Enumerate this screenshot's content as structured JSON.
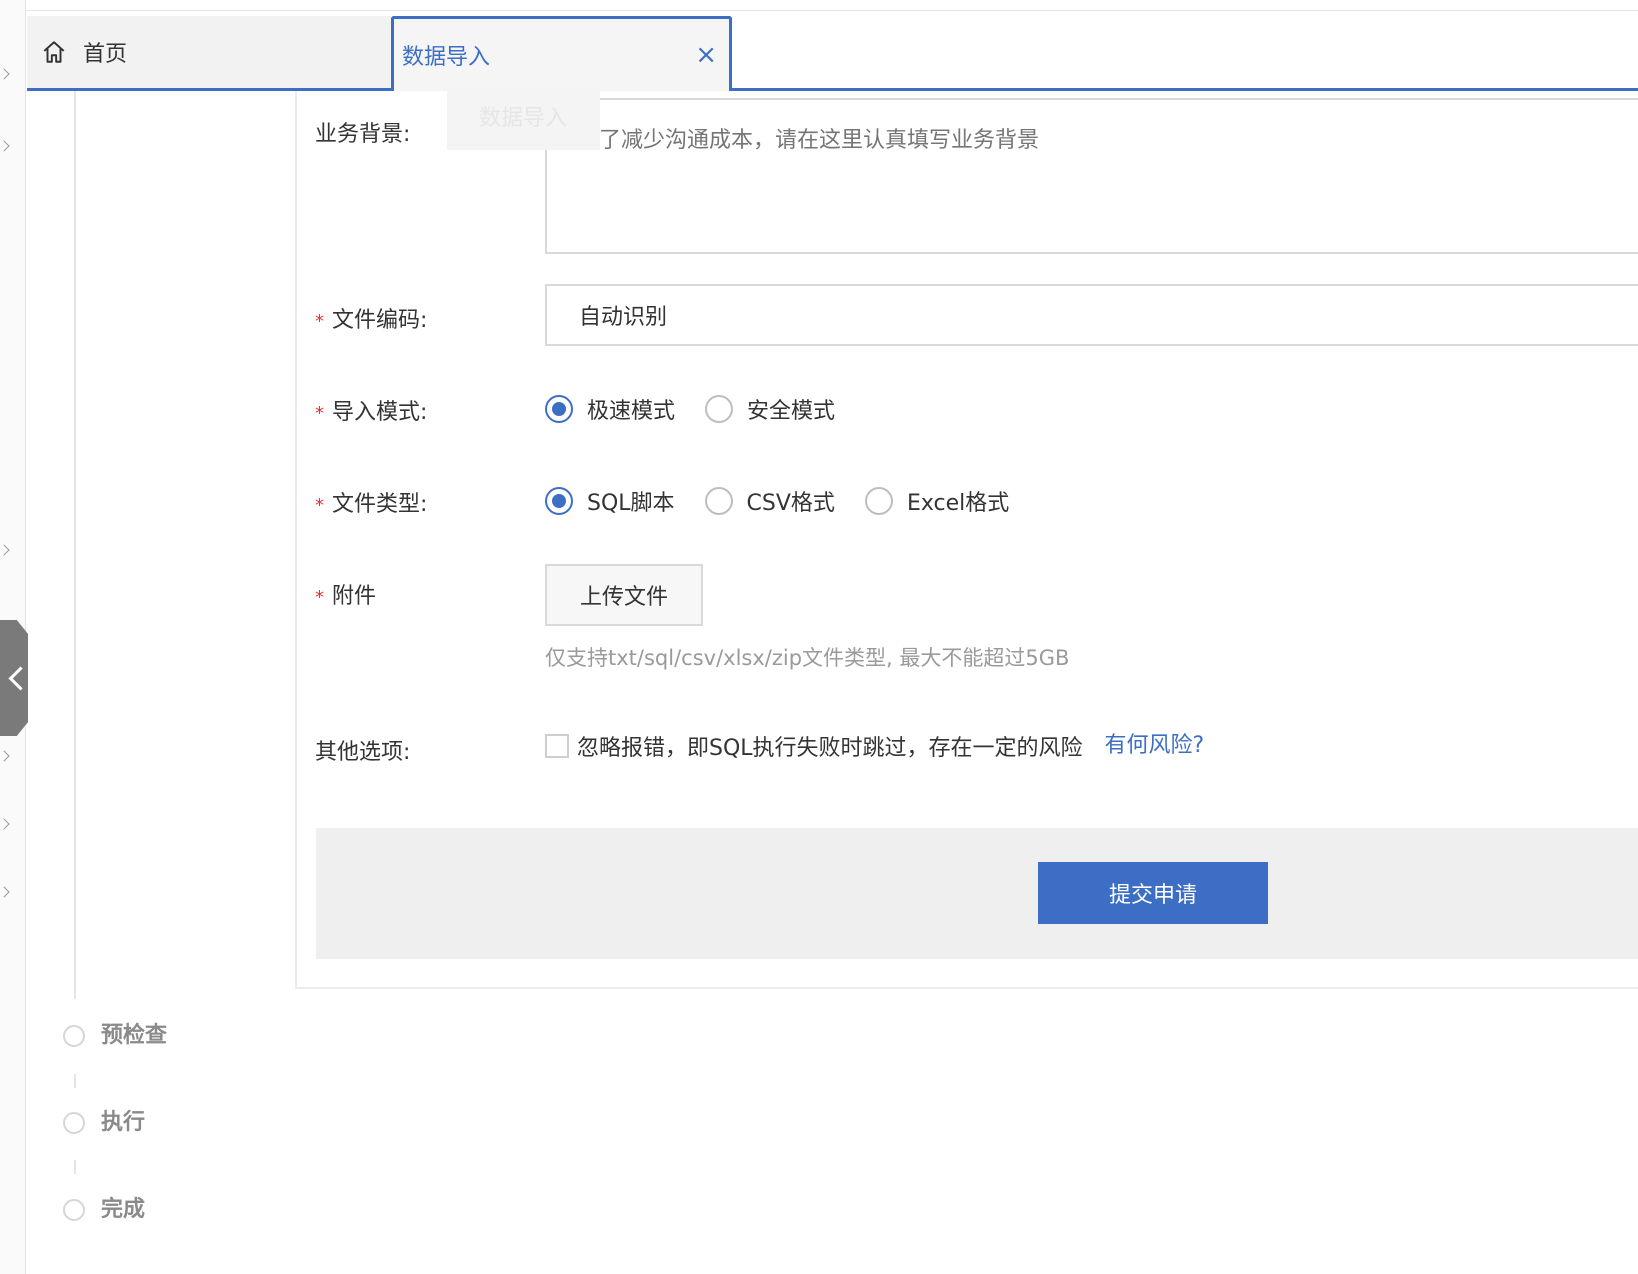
{
  "tabs": {
    "home_label": "首页",
    "active_label": "数据导入",
    "close_symbol": "×"
  },
  "ghost_label": "数据导入",
  "form": {
    "background": {
      "label": "业务背景:",
      "placeholder": "为了减少沟通成本，请在这里认真填写业务背景"
    },
    "encoding": {
      "required_mark": "*",
      "label": "文件编码:",
      "value": "自动识别"
    },
    "import_mode": {
      "required_mark": "*",
      "label": "导入模式:",
      "options": [
        "极速模式",
        "安全模式"
      ],
      "selected": "极速模式"
    },
    "file_type": {
      "required_mark": "*",
      "label": "文件类型:",
      "options": [
        "SQL脚本",
        "CSV格式",
        "Excel格式"
      ],
      "selected": "SQL脚本"
    },
    "attachment": {
      "required_mark": "*",
      "label": "附件",
      "upload_label": "上传文件",
      "hint": "仅支持txt/sql/csv/xlsx/zip文件类型, 最大不能超过5GB"
    },
    "other": {
      "label": "其他选项:",
      "checkbox_text": "忽略报错，即SQL执行失败时跳过，存在一定的风险",
      "checked": false,
      "link": "有何风险?"
    },
    "submit_label": "提交申请"
  },
  "steps": [
    {
      "label": "预检查"
    },
    {
      "label": "执行"
    },
    {
      "label": "完成"
    }
  ],
  "colors": {
    "accent": "#3d6ec5",
    "required": "#e0342f",
    "hint": "#9a9a9a",
    "footer_bg": "#efefef"
  }
}
